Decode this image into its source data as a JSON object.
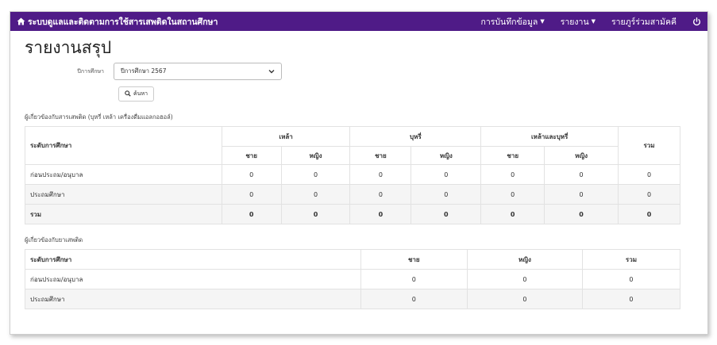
{
  "navbar": {
    "brand": "ระบบดูแลและติดตามการใช้สารเสพติดในสถานศึกษา",
    "menu": [
      {
        "label": "การบันทึกข้อมูล"
      },
      {
        "label": "รายงาน"
      },
      {
        "label": "รายภูร์ร่วมสามัคคี"
      }
    ]
  },
  "page": {
    "title": "รายงานสรุป",
    "year_label": "ปีการศึกษา",
    "year_value": "ปีการศึกษา 2567",
    "search_label": "ค้นหา"
  },
  "table1": {
    "title": "ผู้เกี่ยวข้องกับสารเสพติด (บุหรี่ เหล้า เครื่องดื่มแอลกอฮอล์)",
    "level_header": "ระดับการศึกษา",
    "groups": [
      "เหล้า",
      "บุหรี่",
      "เหล้าและบุหรี่"
    ],
    "total_header": "รวม",
    "male": "ชาย",
    "female": "หญิง",
    "rows": [
      {
        "level": "ก่อนประถม/อนุบาล",
        "values": [
          "0",
          "0",
          "0",
          "0",
          "0",
          "0",
          "0"
        ]
      },
      {
        "level": "ประถมศึกษา",
        "values": [
          "0",
          "0",
          "0",
          "0",
          "0",
          "0",
          "0"
        ]
      },
      {
        "level": "รวม",
        "values": [
          "0",
          "0",
          "0",
          "0",
          "0",
          "0",
          "0"
        ]
      }
    ]
  },
  "table2": {
    "title": "ผู้เกี่ยวข้องกับยาเสพติด",
    "headers": [
      "ระดับการศึกษา",
      "ชาย",
      "หญิง",
      "รวม"
    ],
    "rows": [
      {
        "level": "ก่อนประถม/อนุบาล",
        "values": [
          "0",
          "0",
          "0"
        ]
      },
      {
        "level": "ประถมศึกษา",
        "values": [
          "0",
          "0",
          "0"
        ]
      }
    ]
  },
  "colors": {
    "navbar": "#4f1b87"
  }
}
